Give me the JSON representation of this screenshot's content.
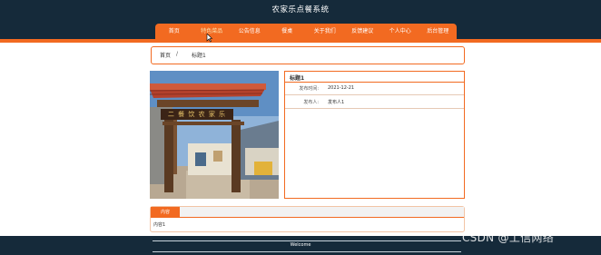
{
  "site": {
    "title": "农家乐点餐系统"
  },
  "nav": {
    "items": [
      {
        "label": "首页"
      },
      {
        "label": "特色菜品"
      },
      {
        "label": "公告信息"
      },
      {
        "label": "餐桌"
      },
      {
        "label": "关于我们"
      },
      {
        "label": "反馈建议"
      },
      {
        "label": "个人中心"
      },
      {
        "label": "后台管理"
      }
    ],
    "active_index": 1
  },
  "breadcrumb": {
    "home": "首页",
    "separator": "/",
    "current": "标题1"
  },
  "detail": {
    "title": "标题1",
    "publish_time_label": "发布时间:",
    "publish_time_value": "2021-12-21",
    "publisher_label": "发布人:",
    "publisher_value": "发布人1"
  },
  "photo": {
    "sign_text": "二 餐 饮 农 家 乐"
  },
  "content": {
    "tab_label": "内容",
    "text": "内容1"
  },
  "footer": {
    "text": "Welcome"
  },
  "watermark": {
    "text": "CSDN @工信网络"
  },
  "colors": {
    "header_bg": "#152a3a",
    "accent": "#f26a21"
  }
}
